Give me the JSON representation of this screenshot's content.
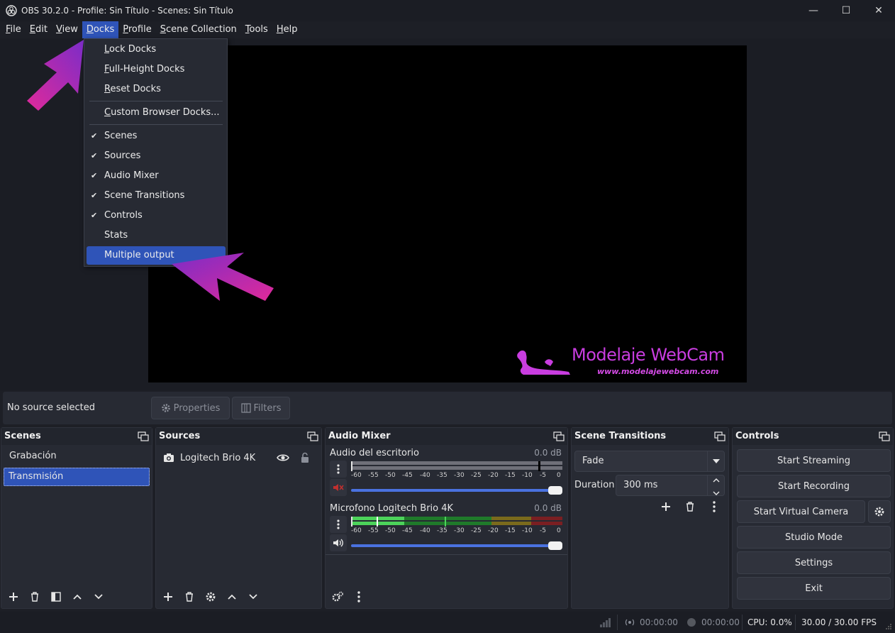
{
  "window": {
    "title": "OBS 30.2.0 - Profile: Sin Título - Scenes: Sin Título",
    "minimize": "—",
    "maximize": "☐",
    "close": "✕"
  },
  "menubar": [
    {
      "label": "File",
      "u": "F",
      "rest": "ile"
    },
    {
      "label": "Edit",
      "u": "E",
      "rest": "dit"
    },
    {
      "label": "View",
      "u": "V",
      "rest": "iew"
    },
    {
      "label": "Docks",
      "u": "D",
      "rest": "ocks"
    },
    {
      "label": "Profile",
      "u": "P",
      "rest": "rofile"
    },
    {
      "label": "Scene Collection",
      "u": "S",
      "rest": "cene Collection"
    },
    {
      "label": "Tools",
      "u": "T",
      "rest": "ools"
    },
    {
      "label": "Help",
      "u": "H",
      "rest": "elp"
    }
  ],
  "docks_menu": {
    "lock_docks": {
      "u": "L",
      "rest": "ock Docks"
    },
    "full_height": {
      "u": "F",
      "rest": "ull-Height Docks"
    },
    "reset_docks": {
      "u": "R",
      "rest": "eset Docks"
    },
    "custom_browser": {
      "u": "C",
      "rest": "ustom Browser Docks..."
    },
    "scenes": "Scenes",
    "sources": "Sources",
    "audio_mixer": "Audio Mixer",
    "scene_transitions": "Scene Transitions",
    "controls": "Controls",
    "stats": "Stats",
    "multiple_output": "Multiple output",
    "checkmark": "✔"
  },
  "watermark": {
    "title": "Modelaje WebCam",
    "url": "www.modelajewebcam.com"
  },
  "propbar": {
    "no_source": "No source selected",
    "properties": "Properties",
    "filters": "Filters"
  },
  "scenes": {
    "title": "Scenes",
    "items": [
      "Grabación",
      "Transmisión"
    ]
  },
  "sources": {
    "title": "Sources",
    "items": [
      "Logitech Brio 4K"
    ]
  },
  "mixer": {
    "title": "Audio Mixer",
    "ticks": [
      "-60",
      "-55",
      "-50",
      "-45",
      "-40",
      "-35",
      "-30",
      "-25",
      "-20",
      "-15",
      "-10",
      "-5",
      "0"
    ],
    "channels": [
      {
        "name": "Audio del escritorio",
        "db": "0.0 dB",
        "muted": true,
        "volume": 1.0
      },
      {
        "name": "Microfono Logitech Brio 4K",
        "db": "0.0 dB",
        "muted": false,
        "volume": 1.0
      }
    ]
  },
  "transitions": {
    "title": "Scene Transitions",
    "selected": "Fade",
    "duration_label": "Duration",
    "duration_value": "300 ms"
  },
  "controls": {
    "title": "Controls",
    "start_streaming": "Start Streaming",
    "start_recording": "Start Recording",
    "start_virtual_camera": "Start Virtual Camera",
    "studio_mode": "Studio Mode",
    "settings": "Settings",
    "exit": "Exit"
  },
  "statusbar": {
    "stream_time": "00:00:00",
    "record_time": "00:00:00",
    "cpu": "CPU: 0.0%",
    "fps": "30.00 / 30.00 FPS"
  },
  "colors": {
    "accent": "#2f54b8",
    "annotation_arrow": "#d63aa8"
  }
}
